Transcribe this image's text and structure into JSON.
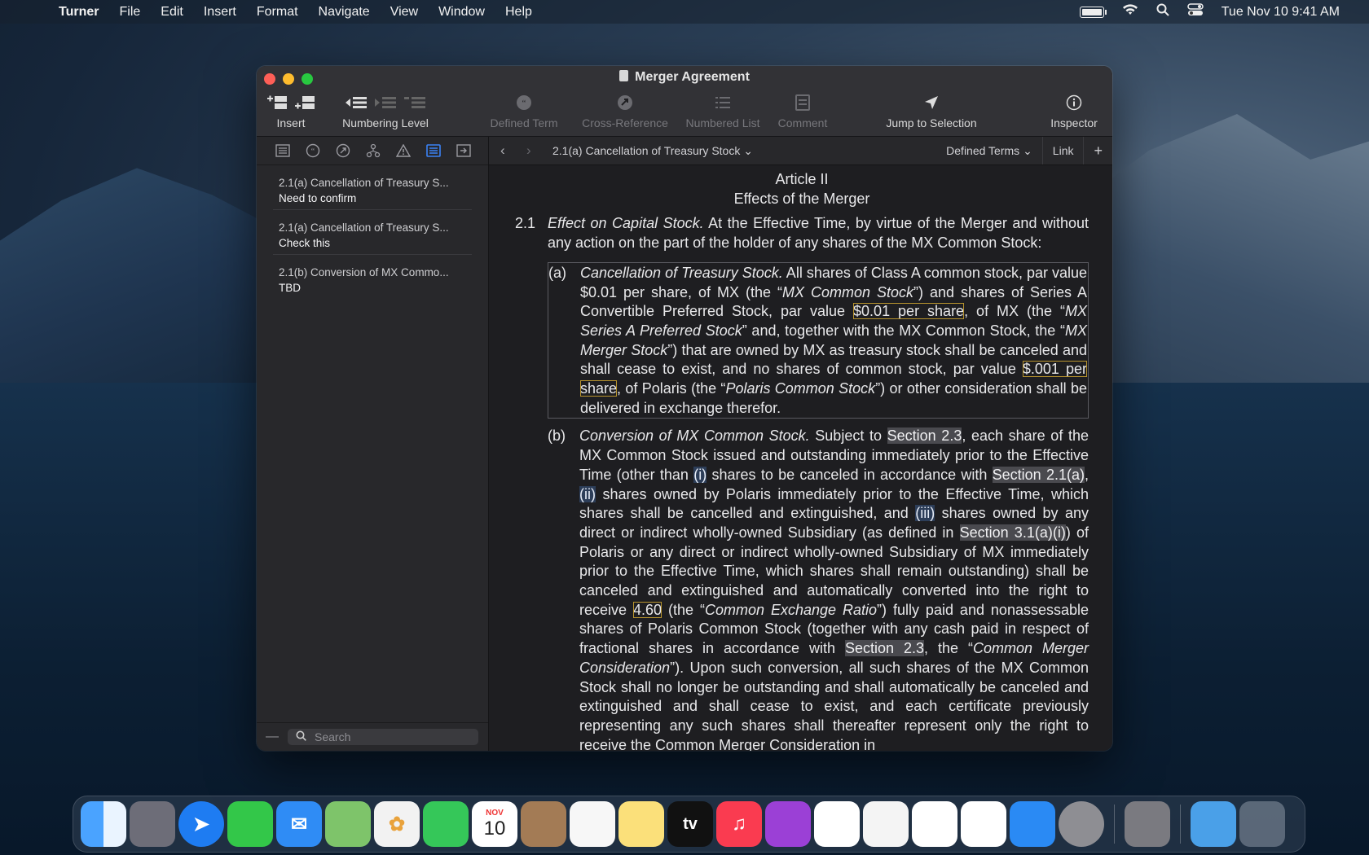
{
  "menubar": {
    "app": "Turner",
    "items": [
      "File",
      "Edit",
      "Insert",
      "Format",
      "Navigate",
      "View",
      "Window",
      "Help"
    ],
    "datetime": "Tue Nov 10  9:41 AM"
  },
  "window": {
    "title": "Merger Agreement",
    "toolbar": {
      "insert": "Insert",
      "numbering": "Numbering Level",
      "defined_term": "Defined Term",
      "cross_reference": "Cross-Reference",
      "numbered_list": "Numbered List",
      "comment": "Comment",
      "jump": "Jump to Selection",
      "inspector": "Inspector"
    }
  },
  "sidebar": {
    "items": [
      {
        "title": "2.1(a) Cancellation of Treasury S...",
        "note": "Need to confirm"
      },
      {
        "title": "2.1(a) Cancellation of Treasury S...",
        "note": "Check this"
      },
      {
        "title": "2.1(b) Conversion of MX Commo...",
        "note": "TBD"
      }
    ],
    "search_placeholder": "Search"
  },
  "editor": {
    "breadcrumb": "2.1(a) Cancellation of Treasury Stock",
    "defined_terms": "Defined Terms",
    "link": "Link",
    "add": "+"
  },
  "document": {
    "article": "Article II",
    "article_title": "Effects of the Merger",
    "sec_num": "2.1",
    "sec_heading": "Effect on Capital Stock.",
    "sec_text": " At the Effective Time, by virtue of the Merger and without any action on the part of the holder of any shares of the MX Common Stock:",
    "a": {
      "label": "(a)",
      "heading": "Cancellation of Treasury Stock.",
      "t1": " All shares of Class A common stock, par value $0.01 per share, of MX (the “",
      "term1": "MX Common Stock",
      "t2": "”) and shares of Series A Convertible Preferred Stock, par value ",
      "val1": "$0.01 per share",
      "t3": ", of MX (the “",
      "term2": "MX Series A Preferred Stock",
      "t4": "” and, together with the MX Common Stock, the “",
      "term3": "MX Merger Stock",
      "t5": "”) that are owned by MX as treasury stock shall be canceled and shall cease to exist, and no shares of common stock, par value ",
      "val2": "$.001 per share",
      "t6": ", of Polaris (the “",
      "term4": "Polaris Common Stock",
      "t7": "”) or other consideration shall be delivered in exchange therefor."
    },
    "b": {
      "label": "(b)",
      "heading": "Conversion of MX Common Stock.",
      "t1": " Subject to ",
      "ref1": "Section 2.3",
      "t2": ", each share of the MX Common Stock issued and outstanding immediately prior to the Effective Time (other than ",
      "m1": "(i)",
      "t3": " shares to be canceled in accordance with ",
      "ref2": "Section 2.1(a)",
      "t4": ", ",
      "m2": "(ii)",
      "t5": " shares owned by Polaris immediately prior to the Effective Time, which shares shall be cancelled and extinguished, and ",
      "m3": "(iii)",
      "t6": " shares owned by any direct or indirect wholly-owned Subsidiary (as defined in ",
      "ref3": "Section 3.1(a)(i)",
      "t7": ") of Polaris or any direct or indirect wholly-owned Subsidiary of MX immediately prior to the Effective Time, which shares shall remain outstanding) shall be canceled and extinguished and automatically converted into the right to receive ",
      "val1": "4.60",
      "t8": " (the “",
      "term1": "Common Exchange Ratio",
      "t9": "”) fully paid and nonassessable shares of Polaris Common Stock (together with any cash paid in respect of fractional shares in accordance with ",
      "ref4": "Section 2.3",
      "t10": ", the “",
      "term2": "Common Merger Consideration",
      "t11": "”). Upon such conversion, all such shares of the MX Common Stock shall no longer be outstanding and shall automatically be canceled and extinguished and shall cease to exist, and each certificate previously representing any such shares shall thereafter represent only the right to receive the Common Merger Consideration in"
    }
  },
  "dock": {
    "calendar_month": "NOV",
    "calendar_day": "10",
    "tv": "tv"
  }
}
